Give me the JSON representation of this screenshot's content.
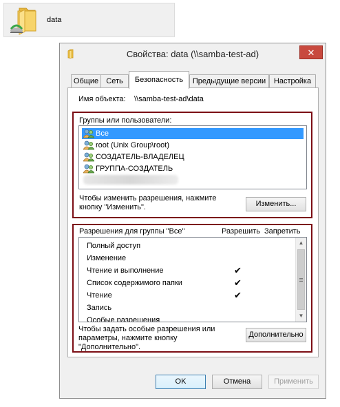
{
  "folder": {
    "label": "data"
  },
  "dialog": {
    "title": "Свойства: data (\\\\samba-test-ad)",
    "close_glyph": "✕",
    "tabs": [
      {
        "label": "Общие"
      },
      {
        "label": "Сеть"
      },
      {
        "label": "Безопасность"
      },
      {
        "label": "Предыдущие версии"
      },
      {
        "label": "Настройка"
      }
    ],
    "active_tab": "Безопасность"
  },
  "security": {
    "object_label": "Имя объекта:",
    "object_value": "\\\\samba-test-ad\\data",
    "groups_label": "Группы или пользователи:",
    "groups": [
      {
        "label": "Все",
        "selected": true
      },
      {
        "label": "root (Unix Group\\root)",
        "selected": false
      },
      {
        "label": "СОЗДАТЕЛЬ-ВЛАДЕЛЕЦ",
        "selected": false
      },
      {
        "label": "ГРУППА-СОЗДАТЕЛЬ",
        "selected": false
      }
    ],
    "change_hint": "Чтобы изменить разрешения, нажмите кнопку \"Изменить\".",
    "change_button": "Изменить...",
    "permissions_label": "Разрешения для группы \"Все\"",
    "allow_header": "Разрешить",
    "deny_header": "Запретить",
    "permissions": [
      {
        "name": "Полный доступ",
        "allow": ""
      },
      {
        "name": "Изменение",
        "allow": ""
      },
      {
        "name": "Чтение и выполнение",
        "allow": "✔"
      },
      {
        "name": "Список содержимого папки",
        "allow": "✔"
      },
      {
        "name": "Чтение",
        "allow": "✔"
      },
      {
        "name": "Запись",
        "allow": ""
      },
      {
        "name": "Особые разрешения",
        "allow": ""
      }
    ],
    "advanced_hint": "Чтобы задать особые разрешения или параметры, нажмите кнопку \"Дополнительно\".",
    "advanced_button": "Дополнительно"
  },
  "footer": {
    "ok": "OK",
    "cancel": "Отмена",
    "apply": "Применить"
  },
  "colors": {
    "selection": "#3399ff",
    "highlight_frame": "#7b0d14",
    "close_button": "#c8493e"
  }
}
